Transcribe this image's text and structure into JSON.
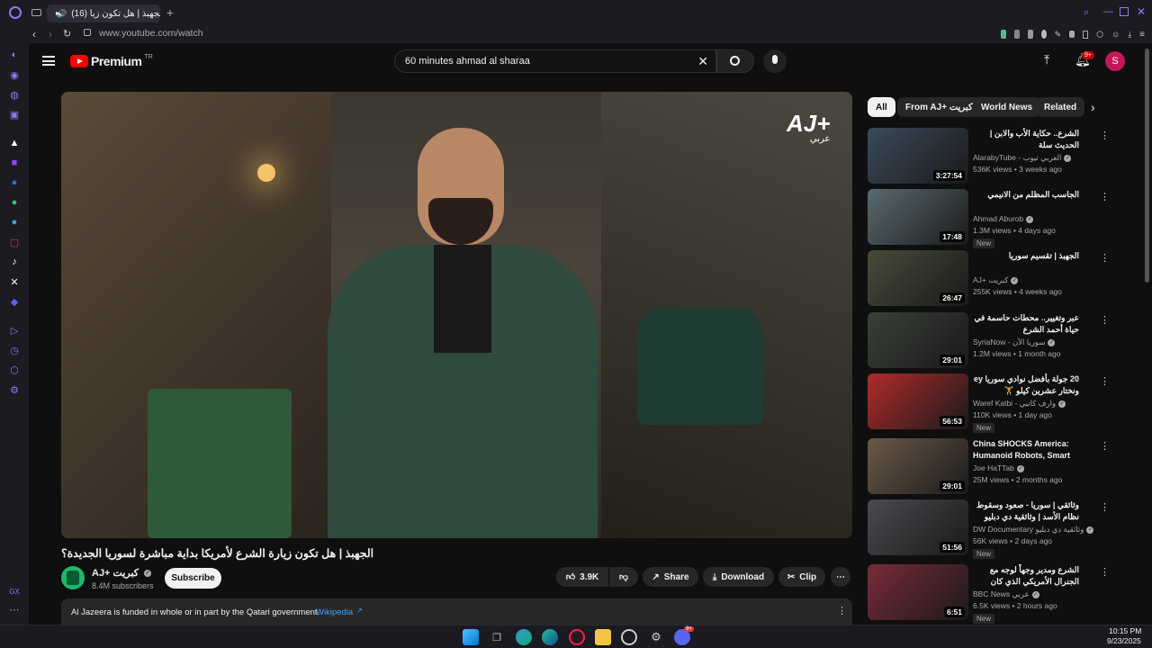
{
  "browser": {
    "tab_title": "(16) الجهبذ | هل تكون زيا",
    "url": "www.youtube.com/watch",
    "taskbar_tray_badge": "9+",
    "opera_gx_label": "GX"
  },
  "youtube": {
    "logo_text": "Premium",
    "logo_sup": "TR",
    "search_query": "60 minutes ahmad al sharaa",
    "notifications_badge": "9+",
    "avatar_letter": "S"
  },
  "video": {
    "overlay_logo": "AJ+",
    "overlay_logo_sub": "عربي",
    "title": "الجهبذ | هل تكون زيارة الشرع لأمريكا بداية مباشرة لسوريا الجديدة؟",
    "channel_name": "AJ+ كبريت",
    "subscribers": "8.4M subscribers",
    "subscribe_label": "Subscribe",
    "likes": "3.9K",
    "share_label": "Share",
    "download_label": "Download",
    "clip_label": "Clip",
    "info_text": "Al Jazeera is funded in whole or in part by the Qatari government.",
    "info_link": "Wikipedia"
  },
  "chips": [
    {
      "label": "All"
    },
    {
      "label": "From AJ+ كبريت"
    },
    {
      "label": "World News"
    },
    {
      "label": "Related"
    }
  ],
  "recommendations": [
    {
      "title": "الشرع.. حكاية الأب والابن | الحديث سلة",
      "channel": "AlarabyTube - العربي تيوب",
      "meta": "536K views • 3 weeks ago",
      "duration": "3:27:54",
      "badge": "",
      "color": "#3a4a5a"
    },
    {
      "title": "الجاسب المظلم من الانيمي",
      "channel": "Ahmad Aburob",
      "meta": "1.3M views • 4 days ago",
      "duration": "17:48",
      "badge": "New",
      "color": "#5a6a70"
    },
    {
      "title": "الجهبذ | تقسيم سوريا",
      "channel": "AJ+ كبريت",
      "meta": "255K views • 4 weeks ago",
      "duration": "26:47",
      "badge": "",
      "color": "#4a4a3a"
    },
    {
      "title": "عبر وتغيير.. محطات حاسمة في حياة أحمد الشرع",
      "channel": "SyriaNow - سوريا الآن",
      "meta": "1.2M views • 1 month ago",
      "duration": "29:01",
      "badge": "",
      "color": "#3a4038"
    },
    {
      "title": "20 جولة بأفضل نوادي سوريا ey ونختار عشرين كيلو 🏋",
      "channel": "Waref Katbi - وارف كاتبي",
      "meta": "110K views • 1 day ago",
      "duration": "56:53",
      "badge": "New",
      "color": "#b02a2a"
    },
    {
      "title": "China SHOCKS America: Humanoid Robots, Smart Citie...",
      "channel": "Joe HaTTab",
      "meta": "25M views • 2 months ago",
      "duration": "29:01",
      "badge": "",
      "color": "#6a5a48"
    },
    {
      "title": "وثائقي | سوريا - صعود وسقوط نظام الأسد | وثائقية دي دبليو",
      "channel": "DW Documentary وثائقية دي دبليو",
      "meta": "56K views • 2 days ago",
      "duration": "51:56",
      "badge": "New",
      "color": "#4a4a50"
    },
    {
      "title": "الشرع ومدير وجهاً لوجه مع الجنرال الأمريكي الذي كان يلاحقه.. الرئيس السوري يجيبه كيف...",
      "channel": "BBC News عربي",
      "meta": "6.5K views • 2 hours ago",
      "duration": "6:51",
      "badge": "New",
      "color": "#7a2a3a"
    }
  ],
  "clock": {
    "time": "10:15 PM",
    "date": "9/23/2025"
  },
  "colors": {
    "youtube_red": "#ff0000",
    "background": "#0f0f0f",
    "chip_bg": "#272727",
    "link_blue": "#3ea6ff"
  }
}
